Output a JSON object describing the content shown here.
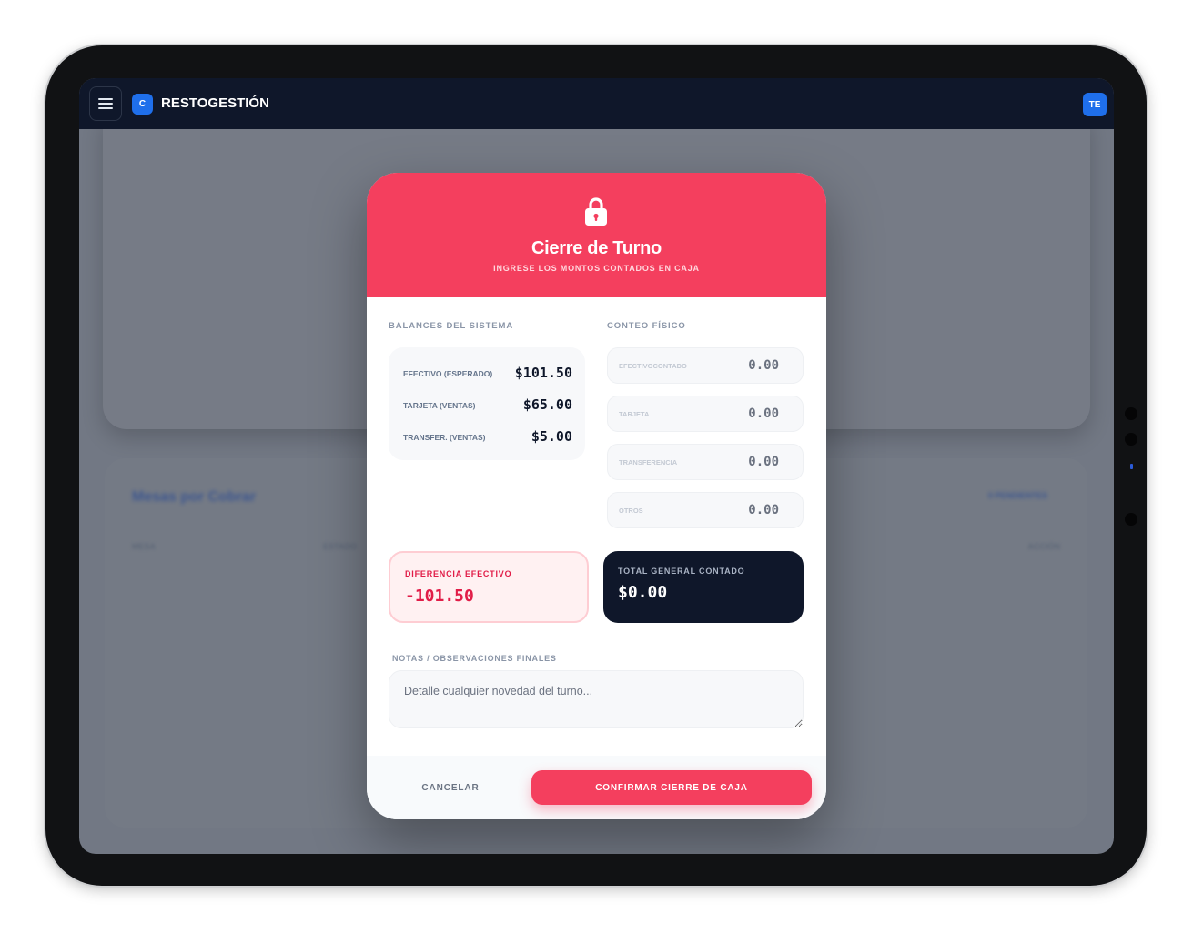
{
  "app": {
    "brand_logo_letter": "C",
    "brand_name": "RESTOGESTIÓN",
    "user_initials": "TE"
  },
  "background": {
    "section_title": "Mesas por Cobrar",
    "badge": "0 PENDIENTES",
    "columns": [
      "MESA",
      "ESTADO",
      "ACCIÓN"
    ]
  },
  "modal": {
    "title": "Cierre de Turno",
    "subtitle": "INGRESE LOS MONTOS CONTADOS EN CAJA",
    "system_label": "BALANCES DEL SISTEMA",
    "physical_label": "CONTEO FÍSICO",
    "system_rows": [
      {
        "label": "EFECTIVO (ESPERADO)",
        "value": "$101.50"
      },
      {
        "label": "TARJETA (VENTAS)",
        "value": "$65.00"
      },
      {
        "label": "TRANSFER. (VENTAS)",
        "value": "$5.00"
      }
    ],
    "physical_fields": [
      {
        "label": "EFECTIVOCONTADO",
        "value": "0.00"
      },
      {
        "label": "TARJETA",
        "value": "0.00"
      },
      {
        "label": "TRANSFERENCIA",
        "value": "0.00"
      },
      {
        "label": "OTROS",
        "value": "0.00"
      }
    ],
    "difference": {
      "label": "DIFERENCIA EFECTIVO",
      "value": "-101.50"
    },
    "total": {
      "label": "TOTAL GENERAL CONTADO",
      "value": "$0.00"
    },
    "notes": {
      "label": "NOTAS / OBSERVACIONES FINALES",
      "placeholder": "Detalle cualquier novedad del turno..."
    },
    "cancel_label": "CANCELAR",
    "confirm_label": "CONFIRMAR CIERRE DE CAJA"
  },
  "colors": {
    "accent": "#f43f5e",
    "navy": "#0f172a",
    "brand_blue": "#1f6feb"
  }
}
